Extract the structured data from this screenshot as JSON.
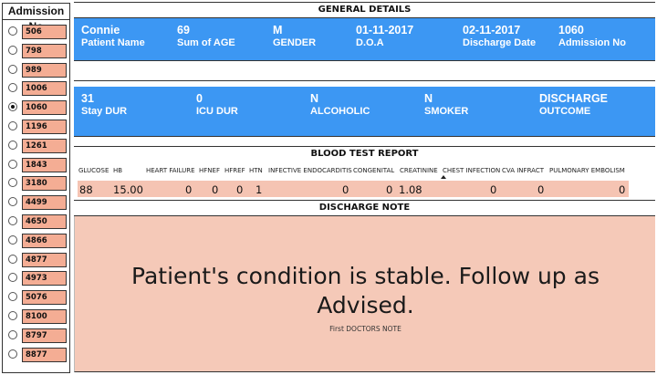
{
  "slicer": {
    "title": "Admission No",
    "items": [
      "506",
      "798",
      "989",
      "1006",
      "1060",
      "1196",
      "1261",
      "1843",
      "3180",
      "4499",
      "4650",
      "4866",
      "4877",
      "4973",
      "5076",
      "8100",
      "8797",
      "8877"
    ],
    "selected": "1060"
  },
  "general": {
    "title": "GENERAL DETAILS",
    "stats": [
      {
        "value": "Connie",
        "label": "Patient Name"
      },
      {
        "value": "69",
        "label": "Sum of AGE"
      },
      {
        "value": "M",
        "label": "GENDER"
      },
      {
        "value": "01-11-2017",
        "label": "D.O.A"
      },
      {
        "value": "02-11-2017",
        "label": "Discharge Date"
      },
      {
        "value": "1060",
        "label": "Admission No"
      }
    ]
  },
  "stay": {
    "stats": [
      {
        "value": "31",
        "label": "Stay DUR"
      },
      {
        "value": "0",
        "label": "ICU DUR"
      },
      {
        "value": "N",
        "label": "ALCOHOLIC"
      },
      {
        "value": "N",
        "label": "SMOKER"
      },
      {
        "value": "DISCHARGE",
        "label": "OUTCOME"
      }
    ]
  },
  "blood": {
    "title": "BLOOD TEST REPORT",
    "headers": [
      "GLUCOSE",
      "HB",
      "HEART FAILURE",
      "HFNEF",
      "HFREF",
      "HTN",
      "INFECTIVE ENDOCARDITIS",
      "CONGENITAL",
      "CREATININE",
      "CHEST INFECTION",
      "CVA INFRACT",
      "PULMONARY EMBOLISM"
    ],
    "values": [
      "88",
      "15.00",
      "0",
      "0",
      "0",
      "1",
      "0",
      "0",
      "1.08",
      "0",
      "0",
      "0"
    ]
  },
  "discharge": {
    "title": "DISCHARGE NOTE",
    "note": "Patient's condition is stable. Follow up as Advised.",
    "sub": "First DOCTORS NOTE"
  },
  "colors": {
    "panel_blue": "#3c97f3",
    "chip_salmon": "#f4ad94",
    "note_bg": "#f5c9b8",
    "row_bg": "#f5c4b3"
  }
}
